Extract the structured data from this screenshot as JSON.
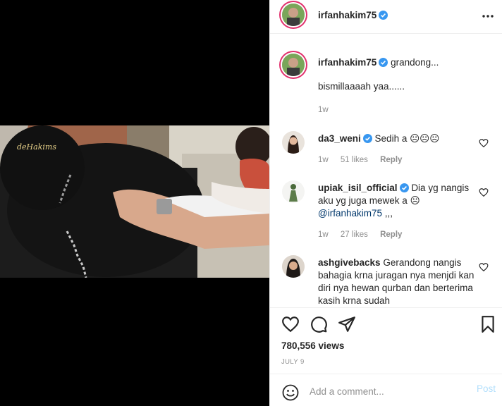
{
  "post": {
    "author": "irfanhakim75",
    "video_watermark": "deHakims",
    "caption_head": "grandong...",
    "caption_body": "bismillaaaah yaa......",
    "caption_time": "1w"
  },
  "comments": [
    {
      "user": "da3_weni",
      "text": "Sedih a ☹☹☹",
      "time": "1w",
      "likes": "51 likes",
      "reply": "Reply"
    },
    {
      "user": "upiak_isil_official",
      "text": "Dia yg nangis aku yg juga mewek a ☹",
      "mention": "@irfanhakim75",
      "mention_suffix": " ,,,",
      "time": "1w",
      "likes": "27 likes",
      "reply": "Reply"
    },
    {
      "user": "ashgivebacks",
      "text": "Gerandong nangis bahagia krna juragan nya menjdi kan diri nya hewan qurban dan berterima kasih krna sudah"
    }
  ],
  "stats": {
    "views": "780,556 views",
    "date": "JULY 9"
  },
  "add_comment": {
    "placeholder": "Add a comment...",
    "post_label": "Post"
  },
  "colors": {
    "verified": "#3897f0",
    "ring": "#e1306c",
    "post_disabled": "#b2dffc"
  },
  "icons": [
    "more-icon",
    "verified-icon",
    "heart-icon",
    "comment-icon",
    "share-icon",
    "bookmark-icon",
    "emoji-icon"
  ]
}
